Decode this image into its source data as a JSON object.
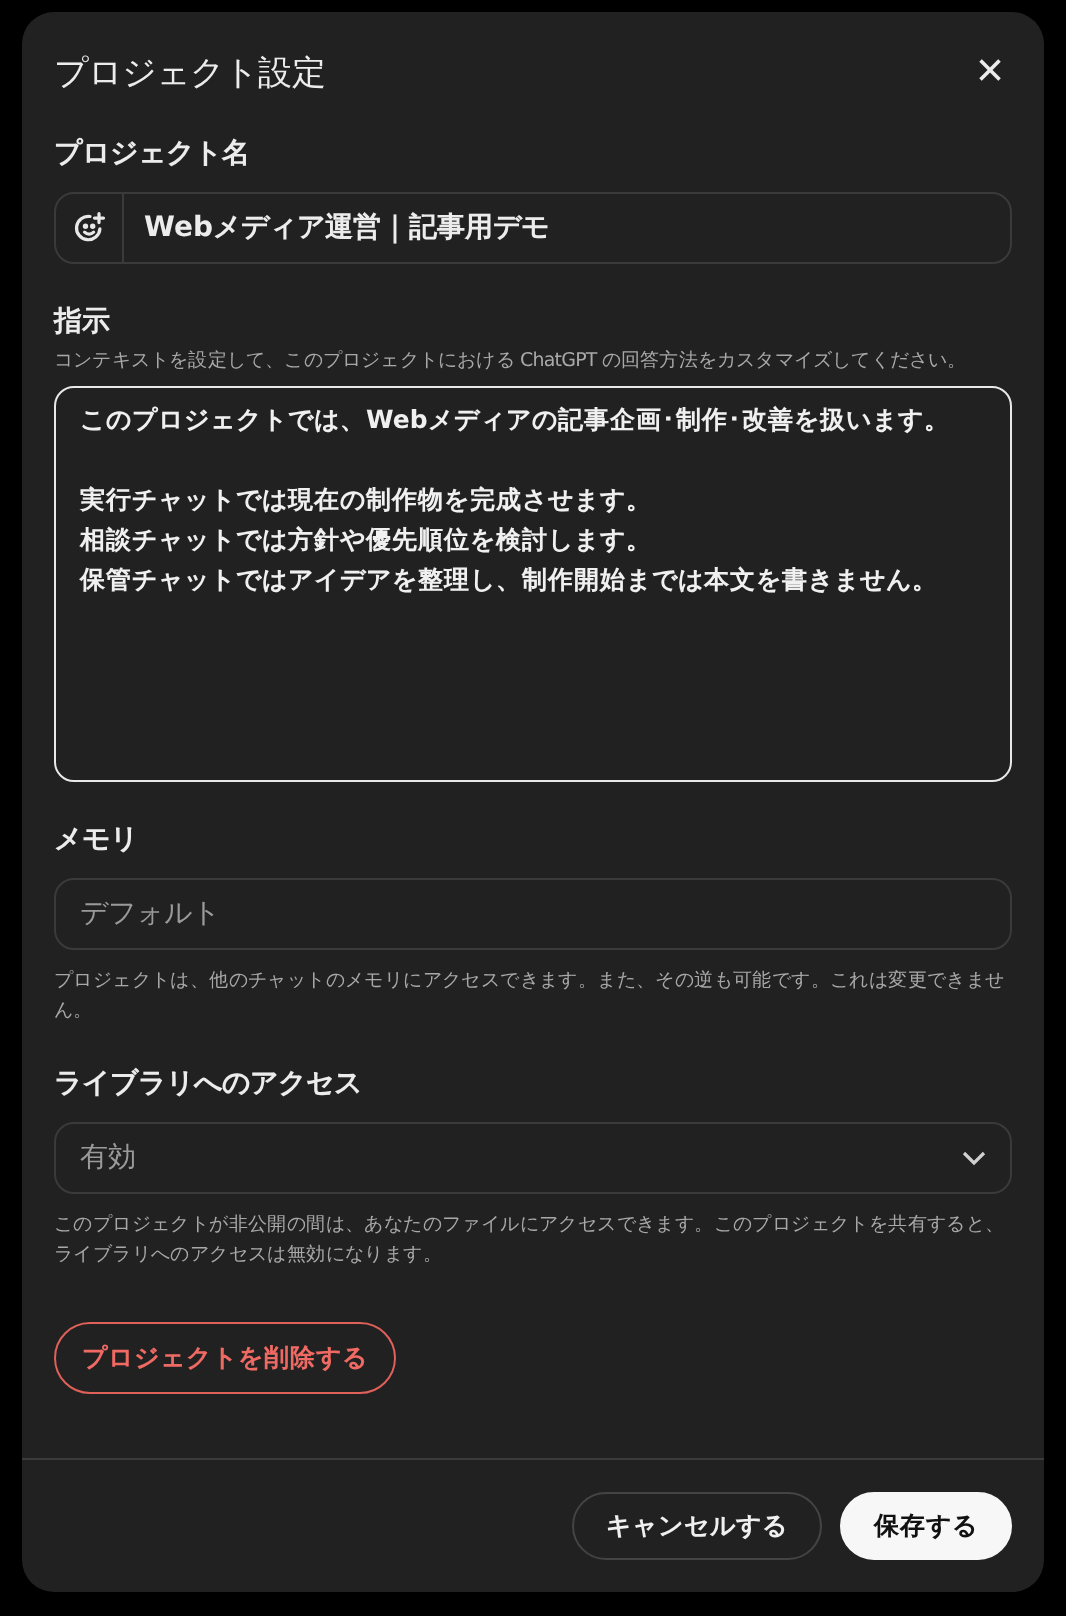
{
  "dialog": {
    "title": "プロジェクト設定",
    "close": "×"
  },
  "project_name": {
    "label": "プロジェクト名",
    "value": "Webメディア運営｜記事用デモ"
  },
  "instructions": {
    "label": "指示",
    "hint": "コンテキストを設定して、このプロジェクトにおける ChatGPT の回答方法をカスタマイズしてください。",
    "paragraphs": [
      [
        "このプロジェクトでは、Webメディアの記事企画･制作･改善を扱います。"
      ],
      [
        "実行チャットでは現在の制作物を完成させます。",
        "相談チャットでは方針や優先順位を検討します。",
        "保管チャットではアイデアを整理し、制作開始までは本文を書きません。"
      ]
    ],
    "focused": true
  },
  "memory": {
    "label": "メモリ",
    "value": "デフォルト",
    "disabled": true,
    "note": "プロジェクトは、他のチャットのメモリにアクセスできます。また、その逆も可能です。これは変更できません。"
  },
  "library_access": {
    "label": "ライブラリへのアクセス",
    "value": "有効",
    "note": "このプロジェクトが非公開の間は、あなたのファイルにアクセスできます。このプロジェクトを共有すると、ライブラリへのアクセスは無効になります。"
  },
  "delete_button": "プロジェクトを削除する",
  "buttons": [
    {
      "label": "キャンセルする",
      "kind": "secondary"
    },
    {
      "label": "保存する",
      "kind": "primary"
    }
  ]
}
